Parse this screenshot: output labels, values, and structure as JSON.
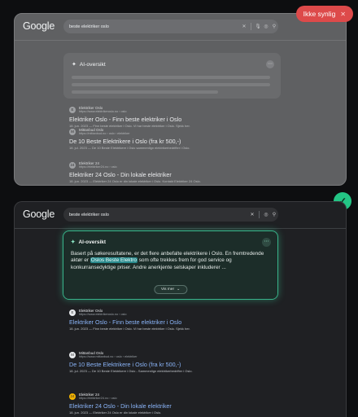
{
  "badge": {
    "label": "Ikke synlig",
    "close": "✕"
  },
  "top": {
    "logo": "Google",
    "query": "beste elektriker oslo",
    "overview_title": "AI-oversikt",
    "results": [
      {
        "favicon": "E",
        "name": "Elektriker Oslo",
        "url": "https://www.elektrikeroslo.no › oslo",
        "title": "Elektriker Oslo - Finn beste elektriker i Oslo",
        "snippet": "18. jun. 2023 — Finn beste elektriker i Oslo. Vi har beste elektriker i Oslo. Sjekk her."
      },
      {
        "favicon": "M",
        "name": "Mittanbud Oslo",
        "url": "https://mittanbud.no › oslo › elektriker",
        "title": "De 10 Beste Elektrikere i Oslo (fra kr 500,-)",
        "snippet": "18. jul. 2023 — De 10 Beste Elektrikere i Oslo sammenlign elektrikerbedrifter i Oslo."
      },
      {
        "favicon": "24",
        "name": "Elektriker 24",
        "url": "https://elektriker24.no › oslo",
        "title": "Elektriker 24 Oslo - Din lokale elektriker",
        "snippet": "18. jun. 2023 — Elektriker 24 Oslo er din lokale elektriker i Oslo. Kontakt Elektriker 24 Oslo."
      }
    ]
  },
  "bottom": {
    "logo": "Google",
    "query": "beste elektriker oslo",
    "overview": {
      "title": "AI-oversikt",
      "text_before": "Basert på søkeresultatene, er det flere anbefalte elektrikere i Oslo. En fremtredende aktør er ",
      "highlight": "Oslos Beste Elektro",
      "text_after": " som ofte trekkes frem for god service og konkurransedyktige priser. Andre anerkjente selskaper inkluderer ...",
      "more_button": "Vis mer"
    },
    "results": [
      {
        "favicon": "E",
        "name": "Elektriker Oslo",
        "url": "https://www.elektrikeroslo.no › oslo",
        "title": "Elektriker Oslo - Finn beste elektriker i Oslo",
        "snippet": "18. jun. 2023 — Finn beste elektriker i Oslo. Vi har beste elektriker i Oslo. Sjekk her."
      },
      {
        "favicon": "M",
        "name": "Mittanbud Oslo",
        "url": "https://www.mittanbud.no › oslo › elektriker",
        "title": "De 10 Beste Elektrikere i Oslo (fra kr 500,-)",
        "snippet": "18. jul. 2023 — De 10 Beste Elektrikere i Oslo - Sammenlign elektrikerbedrifter i Oslo."
      },
      {
        "favicon": "24",
        "name": "Elektriker 24",
        "url": "https://elektriker24.no › oslo",
        "title": "Elektriker 24 Oslo - Din lokale elektriker",
        "snippet": "18. jun. 2023 — Elektriker 24 Oslo er din lokale elektriker i Oslo."
      }
    ]
  }
}
